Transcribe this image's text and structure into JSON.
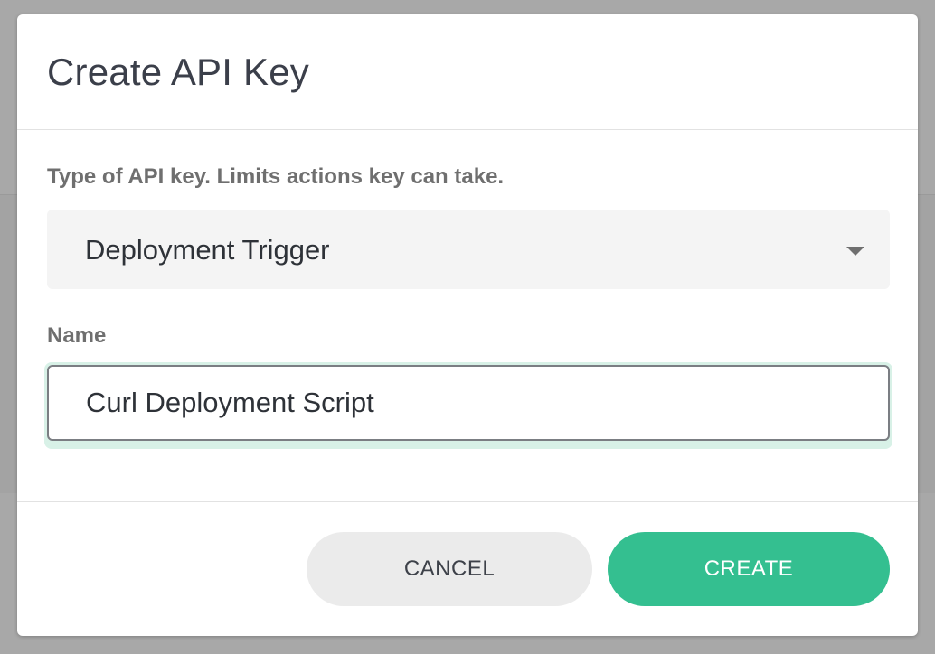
{
  "dialog": {
    "title": "Create API Key",
    "type_label": "Type of API key. Limits actions key can take.",
    "type_value": "Deployment Trigger",
    "name_label": "Name",
    "name_value": "Curl Deployment Script",
    "cancel_label": "CANCEL",
    "create_label": "CREATE"
  },
  "colors": {
    "accent": "#34bf90",
    "focus_ring": "#d8f1e7",
    "title_text": "#3b3f4a",
    "label_text": "#6f6f6f"
  },
  "icons": {
    "dropdown": "chevron-down-icon"
  }
}
